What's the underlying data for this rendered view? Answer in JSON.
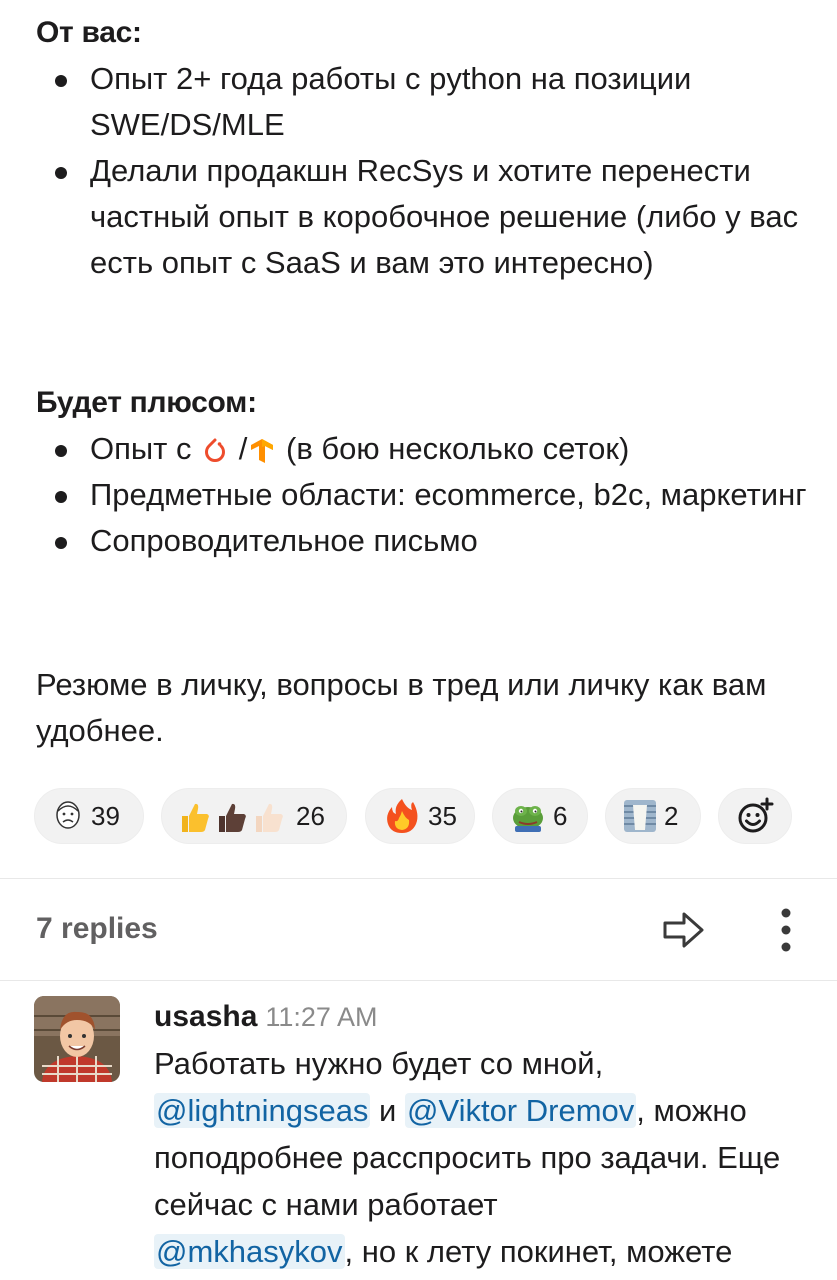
{
  "post": {
    "section1_heading": "От вас:",
    "section1_items": [
      "Опыт 2+ года работы с python на позиции SWE/DS/MLE",
      "Делали продакшн RecSys и хотите перенести частный опыт в коробочное решение (либо у вас есть опыт с SaaS и вам это интересно)"
    ],
    "section2_heading": "Будет плюсом:",
    "section2_item1_prefix": "Опыт с",
    "section2_item1_sep": "/",
    "section2_item1_suffix": "(в бою несколько сеток)",
    "section2_item1_icons": [
      "pytorch-icon",
      "tensorflow-icon"
    ],
    "section2_items_rest": [
      "Предметные области: ecommerce, b2c, маркетинг",
      "Сопроводительное письмо"
    ],
    "closing": "Резюме в личку, вопросы в тред или личку как вам удобнее."
  },
  "reactions": [
    {
      "icon": "meme-face-icon",
      "count": "39"
    },
    {
      "icon": "thumbs-up-icon",
      "count": "26"
    },
    {
      "icon": "fire-icon",
      "count": "35"
    },
    {
      "icon": "pepe-frog-icon",
      "count": "6"
    },
    {
      "icon": "milk-glass-icon",
      "count": "2"
    },
    {
      "icon": "add-reaction-icon",
      "count": ""
    }
  ],
  "thread": {
    "replies_label": "7 replies"
  },
  "reply": {
    "author": "usasha",
    "time": "11:27 AM",
    "text_1": "Работать нужно будет со мной,",
    "mention_1": "@lightningseas",
    "text_2": " и ",
    "mention_2": "@Viktor Dremov",
    "text_3": ", можно поподробнее расспросить про задачи. Еще сейчас с нами работает",
    "mention_3": "@mkhasykov",
    "text_4": ", но к лету покинет, можете"
  },
  "colors": {
    "text": "#1d1c1d",
    "mention": "#1264a3",
    "mention_bg": "#e8f2f8",
    "muted": "#616061",
    "reaction_bg": "#f2f2f2"
  }
}
